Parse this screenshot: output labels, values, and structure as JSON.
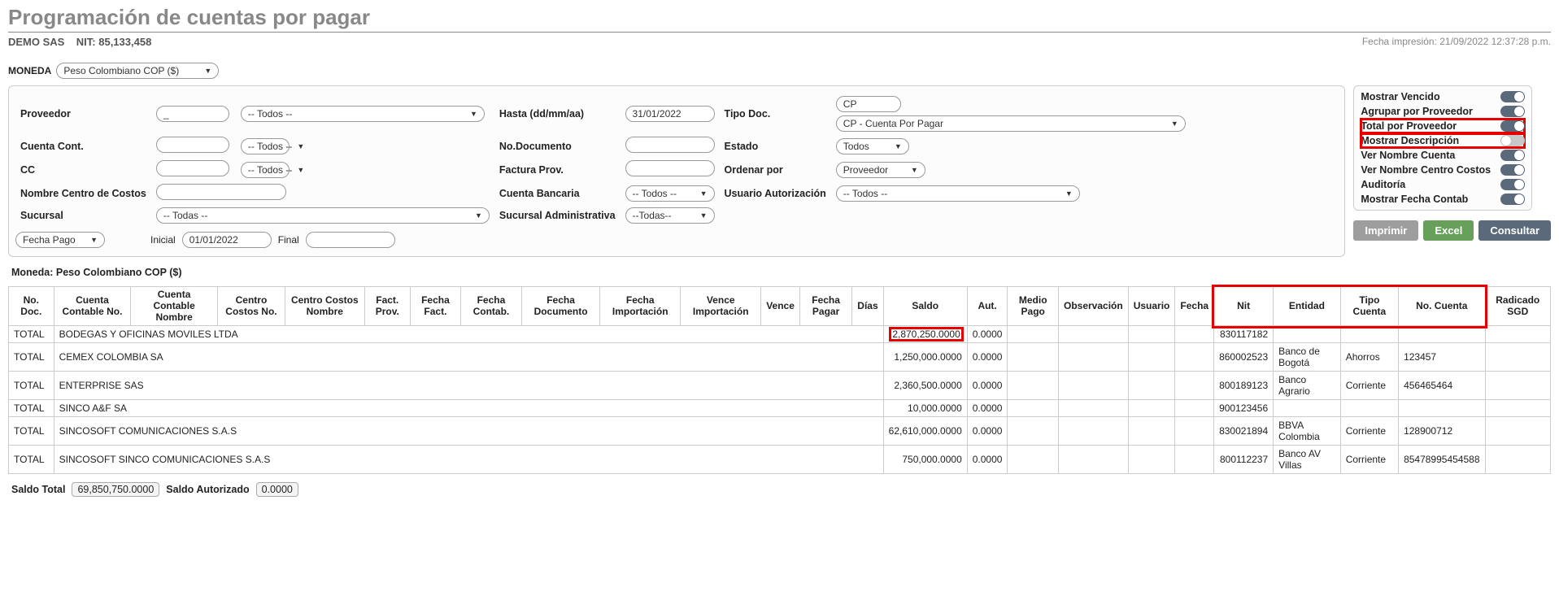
{
  "header": {
    "title": "Programación de cuentas por pagar",
    "company": "DEMO SAS",
    "nit_label": "NIT: 85,133,458",
    "print_ts": "Fecha impresión: 21/09/2022 12:37:28 p.m."
  },
  "currency": {
    "label": "MONEDA",
    "value": "Peso Colombiano COP ($)"
  },
  "filters": {
    "proveedor_label": "Proveedor",
    "proveedor_code": "_",
    "proveedor_sel": "-- Todos --",
    "cuenta_cont_label": "Cuenta Cont.",
    "cuenta_cont_sel": "-- Todos --",
    "cc_label": "CC",
    "cc_sel": "-- Todos --",
    "nombre_cc_label": "Nombre Centro de Costos",
    "sucursal_label": "Sucursal",
    "sucursal_sel": "-- Todas --",
    "fecha_tipo_sel": "Fecha Pago",
    "inicial_label": "Inicial",
    "inicial_val": "01/01/2022",
    "final_label": "Final",
    "hasta_label": "Hasta (dd/mm/aa)",
    "hasta_val": "31/01/2022",
    "nodoc_label": "No.Documento",
    "factura_label": "Factura Prov.",
    "cuenta_banc_label": "Cuenta Bancaria",
    "cuenta_banc_sel": "-- Todos --",
    "suc_admin_label": "Sucursal Administrativa",
    "suc_admin_sel": "--Todas--",
    "tipo_doc_label": "Tipo Doc.",
    "tipo_doc_code": "CP",
    "tipo_doc_sel": "CP - Cuenta Por Pagar",
    "estado_label": "Estado",
    "estado_sel": "Todos",
    "ordenar_label": "Ordenar por",
    "ordenar_sel": "Proveedor",
    "usuario_aut_label": "Usuario Autorización",
    "usuario_aut_sel": "-- Todos --"
  },
  "toggles": [
    {
      "label": "Mostrar Vencido",
      "on": true
    },
    {
      "label": "Agrupar por Proveedor",
      "on": true
    },
    {
      "label": "Total por Proveedor",
      "on": true,
      "highlight": true
    },
    {
      "label": "Mostrar Descripción",
      "on": false,
      "highlight": true
    },
    {
      "label": "Ver Nombre Cuenta",
      "on": true
    },
    {
      "label": "Ver Nombre Centro Costos",
      "on": true
    },
    {
      "label": "Auditoría",
      "on": true
    },
    {
      "label": "Mostrar Fecha Contab",
      "on": true
    }
  ],
  "buttons": {
    "print": "Imprimir",
    "excel": "Excel",
    "query": "Consultar"
  },
  "report": {
    "moneda_line": "Moneda: Peso Colombiano COP ($)",
    "columns": [
      "No. Doc.",
      "Cuenta Contable No.",
      "Cuenta Contable Nombre",
      "Centro Costos No.",
      "Centro Costos Nombre",
      "Fact. Prov.",
      "Fecha Fact.",
      "Fecha Contab.",
      "Fecha Documento",
      "Fecha Importación",
      "Vence Importación",
      "Vence",
      "Fecha Pagar",
      "Días",
      "Saldo",
      "Aut.",
      "Medio Pago",
      "Observación",
      "Usuario",
      "Fecha",
      "Nit",
      "Entidad",
      "Tipo Cuenta",
      "No. Cuenta",
      "Radicado SGD"
    ],
    "highlight_cols": [
      "Nit",
      "Entidad",
      "Tipo Cuenta",
      "No. Cuenta"
    ],
    "rows": [
      {
        "total": "TOTAL",
        "name": "BODEGAS Y OFICINAS MOVILES LTDA",
        "saldo": "2,870,250.0000",
        "aut": "0.0000",
        "nit": "830117182",
        "entidad": "",
        "tipo": "",
        "cuenta": "",
        "saldo_hl": true
      },
      {
        "total": "TOTAL",
        "name": "CEMEX COLOMBIA SA",
        "saldo": "1,250,000.0000",
        "aut": "0.0000",
        "nit": "860002523",
        "entidad": "Banco de Bogotá",
        "tipo": "Ahorros",
        "cuenta": "123457"
      },
      {
        "total": "TOTAL",
        "name": "ENTERPRISE SAS",
        "saldo": "2,360,500.0000",
        "aut": "0.0000",
        "nit": "800189123",
        "entidad": "Banco Agrario",
        "tipo": "Corriente",
        "cuenta": "456465464"
      },
      {
        "total": "TOTAL",
        "name": "SINCO A&F SA",
        "saldo": "10,000.0000",
        "aut": "0.0000",
        "nit": "900123456",
        "entidad": "",
        "tipo": "",
        "cuenta": ""
      },
      {
        "total": "TOTAL",
        "name": "SINCOSOFT COMUNICACIONES S.A.S",
        "saldo": "62,610,000.0000",
        "aut": "0.0000",
        "nit": "830021894",
        "entidad": "BBVA Colombia",
        "tipo": "Corriente",
        "cuenta": "128900712"
      },
      {
        "total": "TOTAL",
        "name": "SINCOSOFT SINCO COMUNICACIONES S.A.S",
        "saldo": "750,000.0000",
        "aut": "0.0000",
        "nit": "800112237",
        "entidad": "Banco AV Villas",
        "tipo": "Corriente",
        "cuenta": "85478995454588"
      }
    ],
    "saldo_total_label": "Saldo Total",
    "saldo_total_val": "69,850,750.0000",
    "saldo_aut_label": "Saldo Autorizado",
    "saldo_aut_val": "0.0000"
  }
}
